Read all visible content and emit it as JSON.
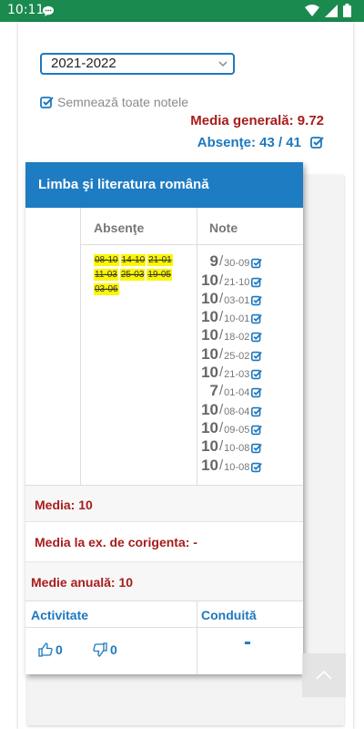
{
  "status_bar": {
    "time": "10:11"
  },
  "year_select": {
    "value": "2021-2022"
  },
  "sign_all": {
    "label": "Semnează toate notele"
  },
  "summary": {
    "media_generala": "Media generală: 9.72",
    "absente": "Absenţe: 43 / 41"
  },
  "subject": {
    "title": "Limba şi literatura română",
    "col_absente": "Absenţe",
    "col_note": "Note",
    "absente": [
      "08-10",
      "14-10",
      "21-01",
      "11-03",
      "25-03",
      "19-05",
      "03-06"
    ],
    "note": [
      {
        "grade": "9",
        "date": "30-09"
      },
      {
        "grade": "10",
        "date": "21-10"
      },
      {
        "grade": "10",
        "date": "03-01"
      },
      {
        "grade": "10",
        "date": "10-01"
      },
      {
        "grade": "10",
        "date": "18-02"
      },
      {
        "grade": "10",
        "date": "25-02"
      },
      {
        "grade": "10",
        "date": "21-03"
      },
      {
        "grade": "7",
        "date": "01-04"
      },
      {
        "grade": "10",
        "date": "08-04"
      },
      {
        "grade": "10",
        "date": "09-05"
      },
      {
        "grade": "10",
        "date": "10-08"
      },
      {
        "grade": "10",
        "date": "10-08"
      }
    ],
    "media": "Media: 10",
    "media_corigenta": "Media la ex. de corigenta: -",
    "medie_anuala": "Medie anuală: 10",
    "activitate_label": "Activitate",
    "conduita_label": "Conduită",
    "likes": "0",
    "dislikes": "0",
    "conduita_value": "-"
  },
  "colors": {
    "status_bar": "#1b8a4f",
    "header": "#1e7cc3",
    "accent_blue": "#1e78be",
    "accent_red": "#a81c1c",
    "highlight": "#fcf600"
  }
}
